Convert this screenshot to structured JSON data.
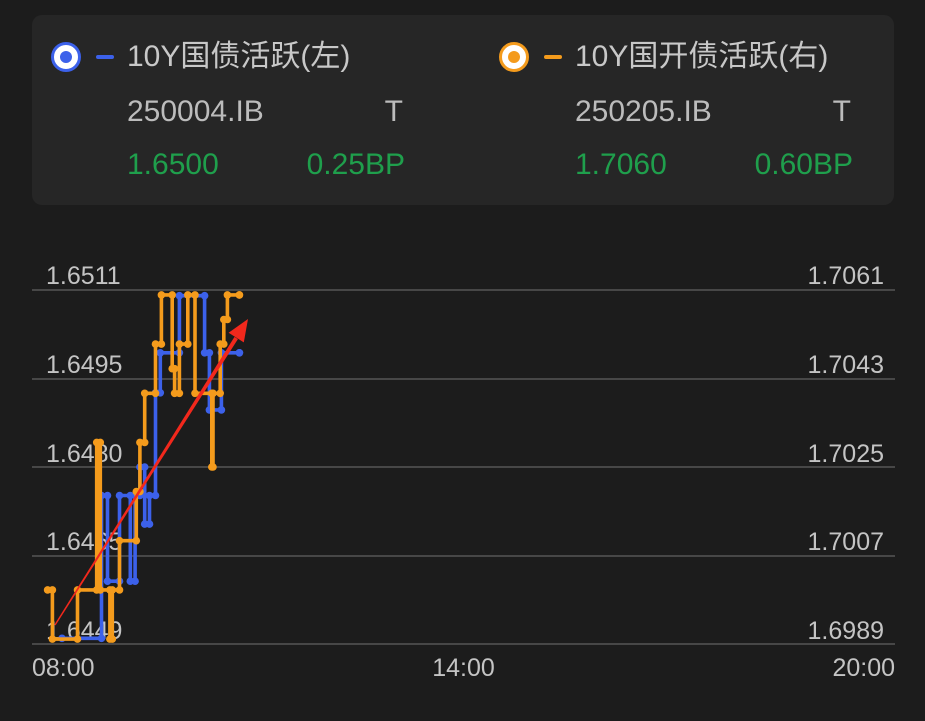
{
  "colors": {
    "background": "#1c1c1c",
    "card": "#262626",
    "text": "#c8c8c8",
    "positive": "#1f9f4c",
    "grid": "#474747",
    "annotation": "#f2281c"
  },
  "chart_data": {
    "type": "line",
    "interpolation": "step",
    "legend_position": "top",
    "grid": true,
    "x_axis": {
      "ticks": [
        "08:00",
        "14:00",
        "20:00"
      ],
      "range": [
        "08:00",
        "20:00"
      ]
    },
    "y_left": {
      "ticks": [
        "1.6511",
        "1.6495",
        "1.6480",
        "1.6465",
        "1.6449"
      ],
      "range": [
        1.6449,
        1.6511
      ]
    },
    "y_right": {
      "ticks": [
        "1.7061",
        "1.7043",
        "1.7025",
        "1.7007",
        "1.6989"
      ],
      "range": [
        1.6989,
        1.7061
      ]
    },
    "series": [
      {
        "name": "10Y国债活跃(左)",
        "code": "250004.IB",
        "tag": "T",
        "last": "1.6500",
        "change": "0.25BP",
        "axis": "left",
        "color": "#3c61ea",
        "points": [
          [
            "08:25",
            1.645
          ],
          [
            "08:58",
            1.6475
          ],
          [
            "09:03",
            1.646
          ],
          [
            "09:13",
            1.6475
          ],
          [
            "09:22",
            1.646
          ],
          [
            "09:26",
            1.6475
          ],
          [
            "09:30",
            1.648
          ],
          [
            "09:34",
            1.647
          ],
          [
            "09:38",
            1.6475
          ],
          [
            "09:43",
            1.6493
          ],
          [
            "09:47",
            1.65
          ],
          [
            "10:03",
            1.651
          ],
          [
            "10:24",
            1.65
          ],
          [
            "10:28",
            1.649
          ],
          [
            "10:38",
            1.65
          ],
          [
            "10:53",
            1.65
          ]
        ]
      },
      {
        "name": "10Y国开债活跃(右)",
        "code": "250205.IB",
        "tag": "T",
        "last": "1.7060",
        "change": "0.60BP",
        "axis": "right",
        "color": "#f49b1c",
        "points": [
          [
            "08:13",
            1.7
          ],
          [
            "08:17",
            1.699
          ],
          [
            "08:38",
            1.7
          ],
          [
            "08:54",
            1.703
          ],
          [
            "08:57",
            1.7
          ],
          [
            "09:05",
            1.699
          ],
          [
            "09:07",
            1.7
          ],
          [
            "09:13",
            1.701
          ],
          [
            "09:27",
            1.702
          ],
          [
            "09:30",
            1.703
          ],
          [
            "09:34",
            1.704
          ],
          [
            "09:43",
            1.705
          ],
          [
            "09:48",
            1.706
          ],
          [
            "09:57",
            1.7045
          ],
          [
            "09:59",
            1.704
          ],
          [
            "10:03",
            1.705
          ],
          [
            "10:10",
            1.706
          ],
          [
            "10:16",
            1.704
          ],
          [
            "10:30",
            1.7025
          ],
          [
            "10:31",
            1.704
          ],
          [
            "10:37",
            1.705
          ],
          [
            "10:40",
            1.7055
          ],
          [
            "10:43",
            1.706
          ],
          [
            "10:53",
            1.706
          ]
        ]
      }
    ]
  }
}
